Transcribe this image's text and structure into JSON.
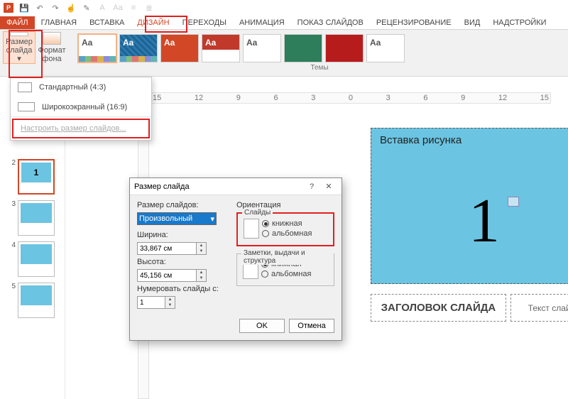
{
  "qat": {
    "icons": [
      "powerpoint",
      "save",
      "undo",
      "redo",
      "touch",
      "format-painter",
      "font",
      "font-size",
      "font-case",
      "bullets",
      "numbering",
      "align",
      "line-spacing",
      "shapes",
      "quick-styles"
    ]
  },
  "tabs": {
    "file": "ФАЙЛ",
    "items": [
      "ГЛАВНАЯ",
      "ВСТАВКА",
      "ДИЗАЙН",
      "ПЕРЕХОДЫ",
      "АНИМАЦИЯ",
      "ПОКАЗ СЛАЙДОВ",
      "РЕЦЕНЗИРОВАНИЕ",
      "ВИД",
      "НАДСТРОЙКИ"
    ],
    "active_index": 2
  },
  "ribbon": {
    "slide_size_btn": "Размер\nслайда ▾",
    "format_bg_btn": "Формат\nфона",
    "themes_caption": "Темы",
    "theme_aa": "Aa"
  },
  "dropdown": {
    "standard": "Стандартный (4:3)",
    "wide": "Широкоэкранный (16:9)",
    "custom": "Настроить размер слайдов..."
  },
  "ruler_marks": [
    "15",
    "12",
    "9",
    "6",
    "3",
    "0",
    "3",
    "6",
    "9",
    "12",
    "15"
  ],
  "thumbs": [
    {
      "n": "2",
      "label": "1",
      "sel": true
    },
    {
      "n": "3",
      "label": "",
      "sel": false
    },
    {
      "n": "4",
      "label": "",
      "sel": false
    },
    {
      "n": "5",
      "label": "",
      "sel": false
    }
  ],
  "slide": {
    "pic_placeholder": "Вставка рисунка",
    "big_number": "1",
    "title_placeholder": "ЗАГОЛОВОК СЛАЙДА",
    "text_placeholder": "Текст слайда"
  },
  "dialog": {
    "title": "Размер слайда",
    "help": "?",
    "close": "✕",
    "size_label": "Размер слайдов:",
    "size_value": "Произвольный",
    "width_label": "Ширина:",
    "width_value": "33,867 см",
    "height_label": "Высота:",
    "height_value": "45,156 см",
    "number_label": "Нумеровать слайды с:",
    "number_value": "1",
    "orient_label": "Ориентация",
    "slides_group": "Слайды",
    "notes_group": "Заметки, выдачи и структура",
    "portrait": "книжная",
    "landscape": "альбомная",
    "ok": "OK",
    "cancel": "Отмена"
  }
}
